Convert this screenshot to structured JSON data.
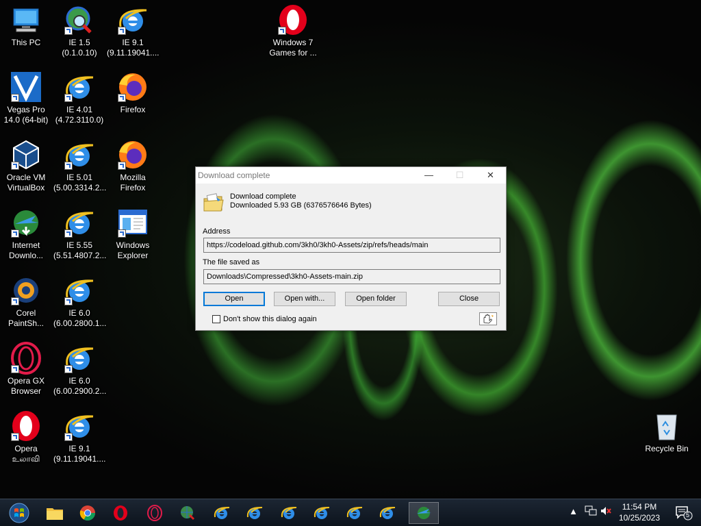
{
  "desktop": {
    "icons": [
      {
        "label": "This PC",
        "icon": "computer-icon"
      },
      {
        "label": "IE 1.5\n(0.1.0.10)",
        "icon": "ie-search-icon"
      },
      {
        "label": "IE 9.1\n(9.11.19041....",
        "icon": "ie-icon"
      },
      {
        "label": "Windows 7\nGames for ...",
        "icon": "opera-icon"
      },
      {
        "label": "Vegas Pro\n14.0 (64-bit)",
        "icon": "vegas-icon"
      },
      {
        "label": "IE 4.01\n(4.72.3110.0)",
        "icon": "ie-icon"
      },
      {
        "label": "Firefox",
        "icon": "firefox-icon"
      },
      {
        "label": "Oracle VM\nVirtualBox",
        "icon": "virtualbox-icon"
      },
      {
        "label": "IE 5.01\n(5.00.3314.2...",
        "icon": "ie-icon"
      },
      {
        "label": "Mozilla\nFirefox",
        "icon": "firefox-icon"
      },
      {
        "label": "Internet\nDownlo...",
        "icon": "idm-icon"
      },
      {
        "label": "IE 5.55\n(5.51.4807.2...",
        "icon": "ie-icon"
      },
      {
        "label": "Windows\nExplorer",
        "icon": "explorer-icon"
      },
      {
        "label": "Corel\nPaintSh...",
        "icon": "corel-icon"
      },
      {
        "label": "IE 6.0\n(6.00.2800.1...",
        "icon": "ie-icon"
      },
      {
        "label": "Opera GX\nBrowser",
        "icon": "opera-gx-icon"
      },
      {
        "label": "IE 6.0\n(6.00.2900.2...",
        "icon": "ie-icon"
      },
      {
        "label": "Opera\nஉலாவி",
        "icon": "opera-icon"
      },
      {
        "label": "IE 9.1\n(9.11.19041....",
        "icon": "ie-icon"
      },
      {
        "label": "Recycle Bin",
        "icon": "recycle-bin-icon"
      }
    ]
  },
  "dialog": {
    "title": "Download complete",
    "heading": "Download complete",
    "subheading": "Downloaded 5.93  GB (6376576646 Bytes)",
    "address_label": "Address",
    "address_value": "https://codeload.github.com/3kh0/3kh0-Assets/zip/refs/heads/main",
    "saved_label": "The file saved as",
    "saved_value": "Downloads\\Compressed\\3kh0-Assets-main.zip",
    "buttons": {
      "open": "Open",
      "open_with": "Open with...",
      "open_folder": "Open folder",
      "close": "Close"
    },
    "checkbox_label": "Don't show this dialog again",
    "window_controls": {
      "minimize": "—",
      "maximize": "☐",
      "close": "✕"
    }
  },
  "taskbar": {
    "time": "11:54 PM",
    "date": "10/25/2023",
    "notification_count": "5",
    "items": [
      "start",
      "file-explorer",
      "chrome",
      "opera",
      "opera-gx",
      "globe",
      "ie",
      "ie",
      "ie",
      "ie",
      "ie",
      "ie",
      "idm"
    ]
  }
}
